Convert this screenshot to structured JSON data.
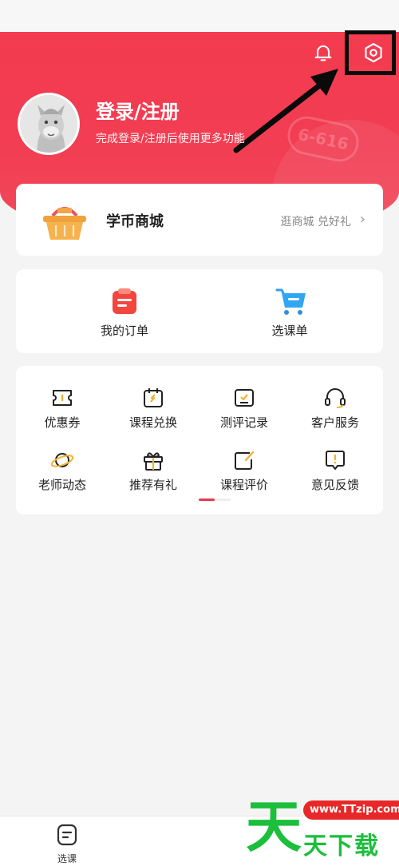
{
  "header": {
    "login_title": "登录/注册",
    "login_subtitle": "完成登录/注册后使用更多功能",
    "decor_tag": "6-616",
    "bell_icon": "bell-icon",
    "settings_icon": "settings-icon",
    "brand_color": "#f23d52"
  },
  "mall": {
    "title": "学币商城",
    "link": "逛商城 兑好礼",
    "chevron": "›",
    "icon": "basket-icon"
  },
  "orders": [
    {
      "label": "我的订单",
      "icon": "order-icon"
    },
    {
      "label": "选课单",
      "icon": "cart-icon"
    }
  ],
  "grid": [
    {
      "label": "优惠券",
      "icon": "coupon-icon"
    },
    {
      "label": "课程兑换",
      "icon": "exchange-icon"
    },
    {
      "label": "测评记录",
      "icon": "test-record-icon"
    },
    {
      "label": "客户服务",
      "icon": "headset-icon"
    },
    {
      "label": "老师动态",
      "icon": "planet-icon"
    },
    {
      "label": "推荐有礼",
      "icon": "gift-icon"
    },
    {
      "label": "课程评价",
      "icon": "edit-icon"
    },
    {
      "label": "意见反馈",
      "icon": "feedback-icon"
    }
  ],
  "tabbar": {
    "items": [
      {
        "label": "选课",
        "icon": "course-tab-icon"
      }
    ]
  },
  "watermark": {
    "big": "天",
    "url": "www.TTzip.com",
    "text": "天下载"
  }
}
